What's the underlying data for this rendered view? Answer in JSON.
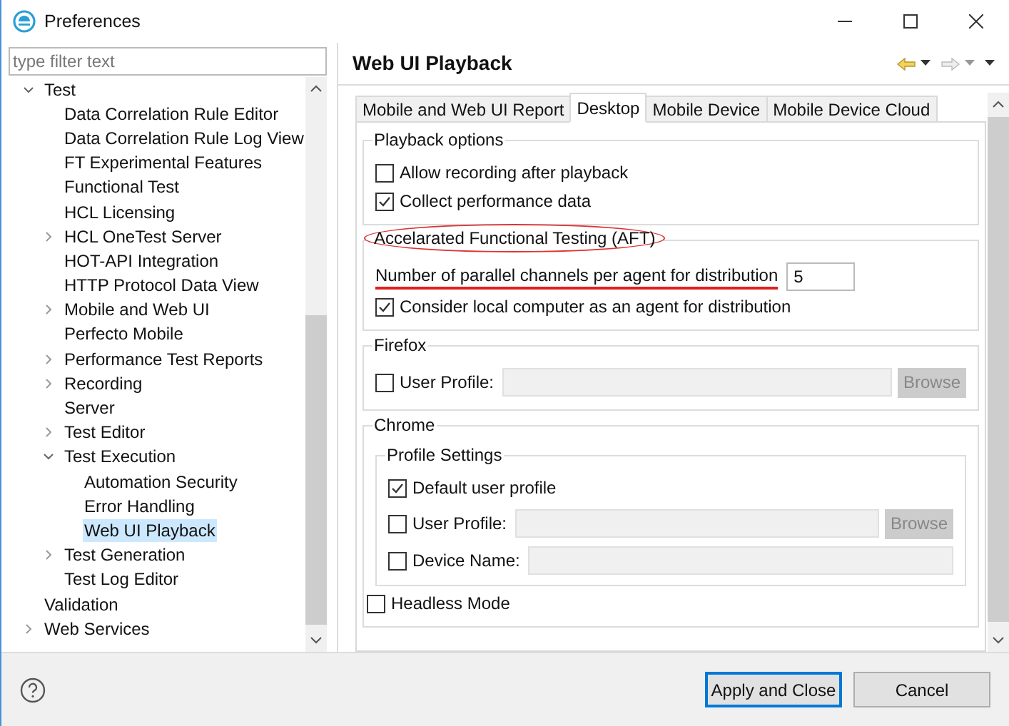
{
  "window": {
    "title": "Preferences"
  },
  "filter": {
    "placeholder": "type filter text"
  },
  "tree": [
    {
      "label": "Test",
      "expanded": true,
      "selected": false,
      "children": [
        {
          "label": "Data Correlation Rule Editor",
          "selected": false
        },
        {
          "label": "Data Correlation Rule Log View",
          "selected": false
        },
        {
          "label": "FT Experimental Features",
          "selected": false
        },
        {
          "label": "Functional Test",
          "selected": false
        },
        {
          "label": "HCL Licensing",
          "selected": false
        },
        {
          "label": "HCL OneTest Server",
          "expanded": false,
          "selected": false
        },
        {
          "label": "HOT-API Integration",
          "selected": false
        },
        {
          "label": "HTTP Protocol Data View",
          "selected": false
        },
        {
          "label": "Mobile and Web UI",
          "expanded": false,
          "selected": false
        },
        {
          "label": "Perfecto Mobile",
          "selected": false
        },
        {
          "label": "Performance Test Reports",
          "expanded": false,
          "selected": false
        },
        {
          "label": "Recording",
          "expanded": false,
          "selected": false
        },
        {
          "label": "Server",
          "selected": false
        },
        {
          "label": "Test Editor",
          "expanded": false,
          "selected": false
        },
        {
          "label": "Test Execution",
          "expanded": true,
          "selected": false,
          "children": [
            {
              "label": "Automation Security",
              "selected": false
            },
            {
              "label": "Error Handling",
              "selected": false
            },
            {
              "label": "Web UI Playback",
              "selected": true
            }
          ]
        },
        {
          "label": "Test Generation",
          "expanded": false,
          "selected": false
        },
        {
          "label": "Test Log Editor",
          "selected": false
        }
      ]
    },
    {
      "label": "Validation",
      "selected": false
    },
    {
      "label": "Web Services",
      "expanded": false,
      "selected": false
    }
  ],
  "page_title": "Web UI Playback",
  "tabs": [
    {
      "label": "Mobile and Web UI Report",
      "selected": false
    },
    {
      "label": "Desktop",
      "selected": true
    },
    {
      "label": "Mobile Device",
      "selected": false
    },
    {
      "label": "Mobile Device Cloud",
      "selected": false
    }
  ],
  "playback_options": {
    "title": "Playback options",
    "options": [
      {
        "label": "Allow recording after playback",
        "checked": false
      },
      {
        "label": "Collect performance data",
        "checked": true
      }
    ]
  },
  "aft": {
    "title": "Accelarated Functional Testing (AFT)",
    "channels_label": "Number of parallel channels per agent for distribution",
    "channels_value": "5",
    "local_agent": {
      "label": "Consider local computer as an agent for distribution",
      "checked": true
    }
  },
  "firefox": {
    "title": "Firefox",
    "user_profile": {
      "label": "User Profile:",
      "checked": false
    },
    "browse": "Browse"
  },
  "chrome": {
    "title": "Chrome",
    "profile_settings": {
      "title": "Profile Settings",
      "default_profile": {
        "label": "Default user profile",
        "checked": true
      },
      "user_profile": {
        "label": "User Profile:",
        "checked": false
      },
      "browse": "Browse",
      "device_name": {
        "label": "Device Name:",
        "checked": false
      }
    }
  },
  "headless": {
    "label": "Headless Mode",
    "checked": false
  },
  "buttons": [
    {
      "label": "Apply and Close",
      "kind": "default"
    },
    {
      "label": "Cancel",
      "kind": "normal"
    }
  ]
}
